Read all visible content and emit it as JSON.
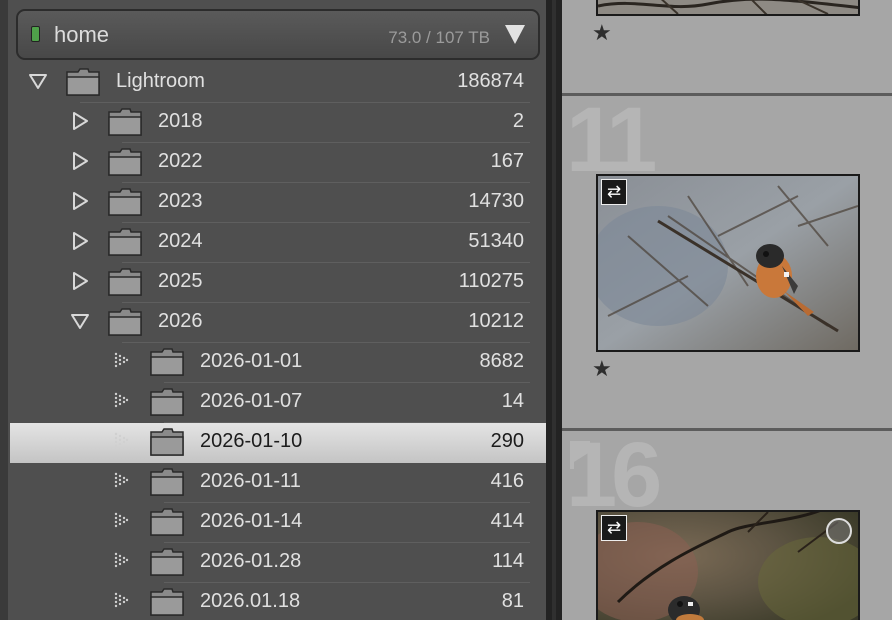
{
  "volume": {
    "name": "home",
    "usage": "73.0 / 107 TB",
    "status_color": "#4fa14a"
  },
  "folders": {
    "root": {
      "name": "Lightroom",
      "count": "186874",
      "expanded": true
    },
    "years": [
      {
        "name": "2018",
        "count": "2",
        "expanded": false
      },
      {
        "name": "2022",
        "count": "167",
        "expanded": false
      },
      {
        "name": "2023",
        "count": "14730",
        "expanded": false
      },
      {
        "name": "2024",
        "count": "51340",
        "expanded": false
      },
      {
        "name": "2025",
        "count": "110275",
        "expanded": false
      },
      {
        "name": "2026",
        "count": "10212",
        "expanded": true
      }
    ],
    "subfolders": [
      {
        "name": "2026-01-01",
        "count": "8682",
        "selected": false
      },
      {
        "name": "2026-01-07",
        "count": "14",
        "selected": false
      },
      {
        "name": "2026-01-10",
        "count": "290",
        "selected": true
      },
      {
        "name": "2026-01-11",
        "count": "416",
        "selected": false
      },
      {
        "name": "2026-01-14",
        "count": "414",
        "selected": false
      },
      {
        "name": "2026-01.28",
        "count": "114",
        "selected": false
      },
      {
        "name": "2026.01.18",
        "count": "81",
        "selected": false
      }
    ]
  },
  "grid": {
    "star_glyph": "★",
    "sync_glyph": "⇄",
    "cells": [
      {
        "index": "",
        "rating": 1
      },
      {
        "index": "11",
        "rating": 1,
        "photo": "redstart-on-branch"
      },
      {
        "index": "16",
        "rating": 0,
        "photo": "redstart-on-branch-dark"
      }
    ]
  },
  "colors": {
    "selection": "#d6d6d6",
    "panel": "#4f4f4f",
    "grid": "#a6a6a6"
  }
}
